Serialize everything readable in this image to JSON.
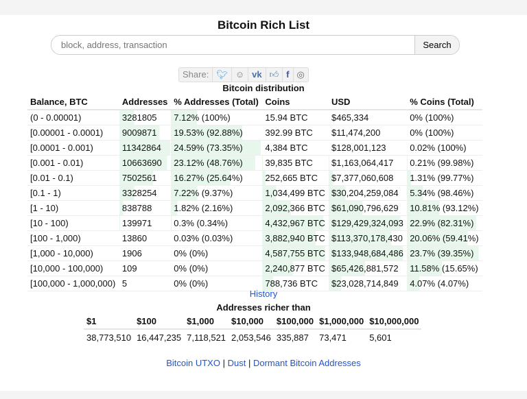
{
  "title": "Bitcoin Rich List",
  "search": {
    "placeholder": "block, address, transaction",
    "button": "Search"
  },
  "share": {
    "label": "Share:",
    "icons": [
      "twitter-icon",
      "reddit-icon",
      "vk-icon",
      "like-icon",
      "facebook-icon",
      "weibo-icon"
    ]
  },
  "bar_color": "#e8f7ec",
  "distribution": {
    "caption": "Bitcoin distribution",
    "headers": [
      "Balance, BTC",
      "Addresses",
      "% Addresses (Total)",
      "Coins",
      "USD",
      "% Coins (Total)"
    ],
    "rows": [
      [
        "(0 - 0.00001)",
        "3281805",
        "7.12% (100%)",
        "15.94 BTC",
        "$465,334",
        "0% (100%)",
        7.12,
        0
      ],
      [
        "[0.00001 - 0.0001)",
        "9009871",
        "19.53% (92.88%)",
        "392.99 BTC",
        "$11,474,200",
        "0% (100%)",
        19.53,
        0
      ],
      [
        "[0.0001 - 0.001)",
        "11342864",
        "24.59% (73.35%)",
        "4,384 BTC",
        "$128,001,123",
        "0.02% (100%)",
        24.59,
        0.02
      ],
      [
        "[0.001 - 0.01)",
        "10663690",
        "23.12% (48.76%)",
        "39,835 BTC",
        "$1,163,064,417",
        "0.21% (99.98%)",
        23.12,
        0.21
      ],
      [
        "[0.01 - 0.1)",
        "7502561",
        "16.27% (25.64%)",
        "252,665 BTC",
        "$7,377,060,608",
        "1.31% (99.77%)",
        16.27,
        1.31
      ],
      [
        "[0.1 - 1)",
        "3328254",
        "7.22% (9.37%)",
        "1,034,499 BTC",
        "$30,204,259,084",
        "5.34% (98.46%)",
        7.22,
        5.34
      ],
      [
        "[1 - 10)",
        "838788",
        "1.82% (2.16%)",
        "2,092,366 BTC",
        "$61,090,796,629",
        "10.81% (93.12%)",
        1.82,
        10.81
      ],
      [
        "[10 - 100)",
        "139971",
        "0.3% (0.34%)",
        "4,432,967 BTC",
        "$129,429,324,093",
        "22.9% (82.31%)",
        0.3,
        22.9
      ],
      [
        "[100 - 1,000)",
        "13860",
        "0.03% (0.03%)",
        "3,882,940 BTC",
        "$113,370,178,430",
        "20.06% (59.41%)",
        0.03,
        20.06
      ],
      [
        "[1,000 - 10,000)",
        "1906",
        "0% (0%)",
        "4,587,755 BTC",
        "$133,948,684,486",
        "23.7% (39.35%)",
        0,
        23.7
      ],
      [
        "[10,000 - 100,000)",
        "109",
        "0% (0%)",
        "2,240,877 BTC",
        "$65,426,881,572",
        "11.58% (15.65%)",
        0,
        11.58
      ],
      [
        "[100,000 - 1,000,000)",
        "5",
        "0% (0%)",
        "788,736 BTC",
        "$23,028,714,849",
        "4.07% (4.07%)",
        0,
        4.07
      ]
    ]
  },
  "history_link": "History",
  "richer": {
    "caption": "Addresses richer than",
    "headers": [
      "$1",
      "$100",
      "$1,000",
      "$10,000",
      "$100,000",
      "$1,000,000",
      "$10,000,000"
    ],
    "values": [
      "38,773,510",
      "16,447,235",
      "7,118,521",
      "2,053,546",
      "335,887",
      "73,471",
      "5,601"
    ]
  },
  "footer_links": [
    "Bitcoin UTXO",
    "Dust",
    "Dormant Bitcoin Addresses"
  ],
  "footer_sep": "|"
}
